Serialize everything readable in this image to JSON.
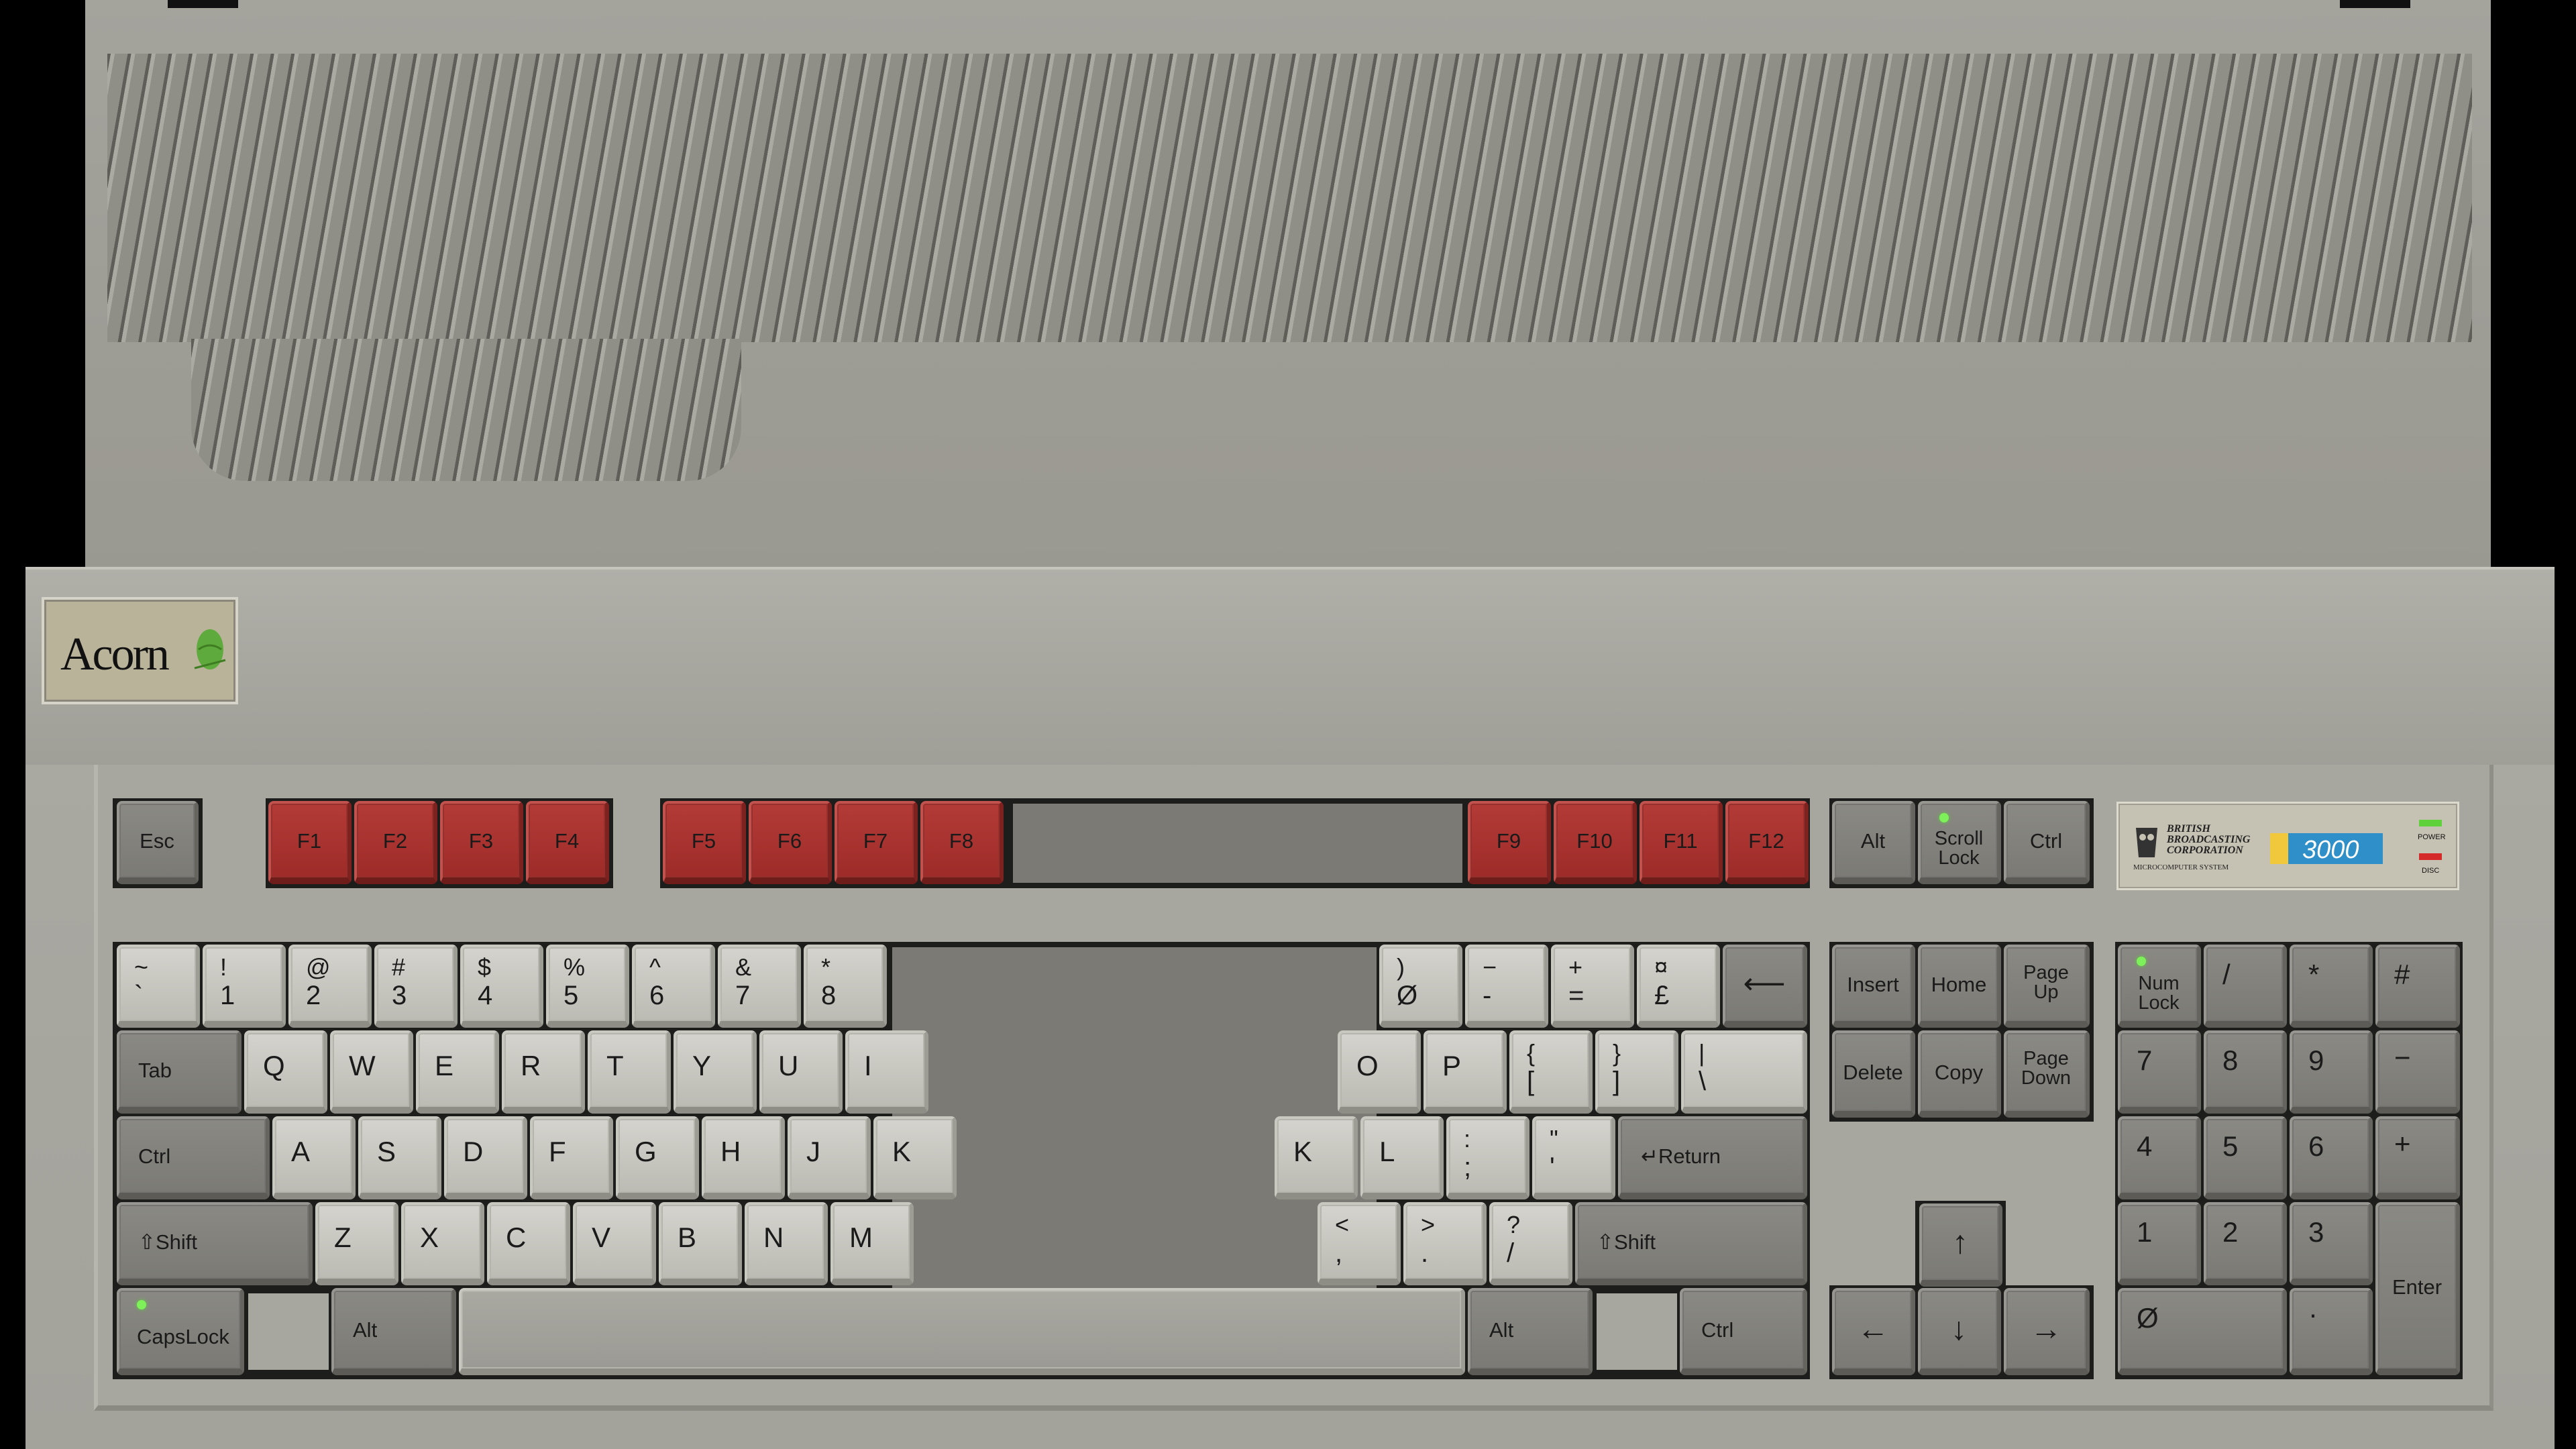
{
  "brand": {
    "name": "Acorn"
  },
  "bbc_badge": {
    "line1": "BRITISH",
    "line2": "BROADCASTING",
    "line3": "CORPORATION",
    "line4": "MICROCOMPUTER SYSTEM",
    "model": "3000",
    "power_label": "POWER",
    "disc_label": "DISC"
  },
  "colors": {
    "power_led": "#5fd13a",
    "disc_led": "#d42a2a",
    "function_key": "#a8322f"
  },
  "keys": {
    "esc": "Esc",
    "f1": "F1",
    "f2": "F2",
    "f3": "F3",
    "f4": "F4",
    "f5": "F5",
    "f6": "F6",
    "f7": "F7",
    "f8": "F8",
    "f9": "F9",
    "f10": "F10",
    "f11": "F11",
    "f12": "F12",
    "alt_top": "Alt",
    "scroll_lock": "Scroll\nLock",
    "ctrl_top": "Ctrl",
    "tilde_top": "~",
    "tilde_bottom": "`",
    "n1_top": "!",
    "n1_bottom": "1",
    "n2_top": "@",
    "n2_bottom": "2",
    "n3_top": "#",
    "n3_bottom": "3",
    "n4_top": "$",
    "n4_bottom": "4",
    "n5_top": "%",
    "n5_bottom": "5",
    "n6_top": "^",
    "n6_bottom": "6",
    "n7_top": "&",
    "n7_bottom": "7",
    "n8_top": "*",
    "n8_bottom": "8",
    "n0_top": ")",
    "n0_bottom": "Ø",
    "minus_top": "−",
    "minus_bottom": "-",
    "equals_top": "+",
    "equals_bottom": "=",
    "pound_top": "¤",
    "pound_bottom": "£",
    "backspace": "⟵",
    "tab": "Tab",
    "q": "Q",
    "w": "W",
    "e": "E",
    "r": "R",
    "t": "T",
    "y": "Y",
    "u": "U",
    "i": "I",
    "o": "O",
    "p": "P",
    "lbrace_top": "{",
    "lbrace_bottom": "[",
    "rbrace_top": "}",
    "rbrace_bottom": "]",
    "pipe_top": "|",
    "pipe_bottom": "\\",
    "ctrl": "Ctrl",
    "a": "A",
    "s": "S",
    "d": "D",
    "f": "F",
    "g": "G",
    "h": "H",
    "j": "J",
    "k_left": "K",
    "k": "K",
    "l": "L",
    "semi_top": ":",
    "semi_bottom": ";",
    "quote_top": "\"",
    "quote_bottom": "'",
    "return": "↵Return",
    "shift_left": "⇧Shift",
    "z": "Z",
    "x": "X",
    "c": "C",
    "v": "V",
    "b": "B",
    "n": "N",
    "m": "M",
    "comma_top": "<",
    "comma_bottom": ",",
    "period_top": ">",
    "period_bottom": ".",
    "slash_top": "?",
    "slash_bottom": "/",
    "shift_right": "⇧Shift",
    "capslock": "CapsLock",
    "alt_left": "Alt",
    "alt_right": "Alt",
    "ctrl_right": "Ctrl",
    "insert": "Insert",
    "home": "Home",
    "page_up": "Page\nUp",
    "delete": "Delete",
    "copy": "Copy",
    "page_down": "Page\nDown",
    "arrow_up": "↑",
    "arrow_left": "←",
    "arrow_down": "↓",
    "arrow_right": "→",
    "num_lock": "Num\nLock",
    "kp_slash": "/",
    "kp_star": "*",
    "kp_hash": "#",
    "kp7": "7",
    "kp8": "8",
    "kp9": "9",
    "kp_minus": "−",
    "kp4": "4",
    "kp5": "5",
    "kp6": "6",
    "kp_plus": "+",
    "kp1": "1",
    "kp2": "2",
    "kp3": "3",
    "kp_enter": "Enter",
    "kp0": "Ø",
    "kp_dot": "·"
  }
}
